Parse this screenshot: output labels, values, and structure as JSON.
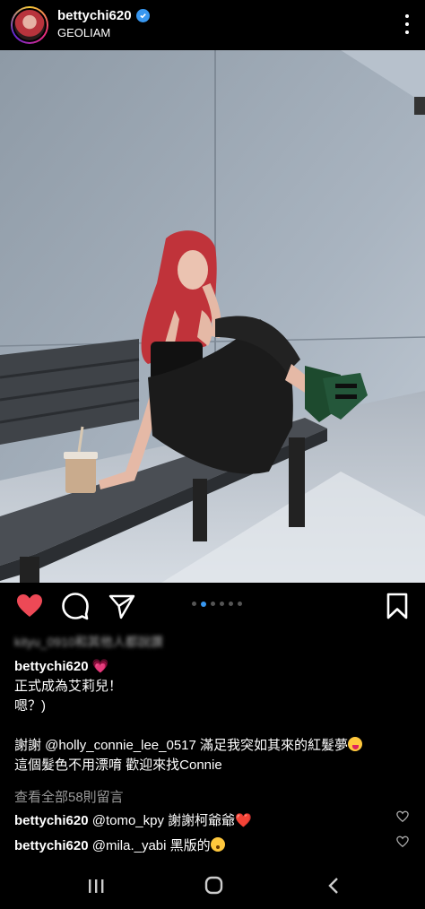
{
  "header": {
    "username": "bettychi620",
    "location": "GEOLIAM",
    "verified": true,
    "avatar_icon": "avatar"
  },
  "post": {
    "carousel": {
      "total": 6,
      "active_index": 1
    },
    "liked_by_text": "kityu_0910和其他人都說讚",
    "caption": {
      "username": "bettychi620",
      "heart": "💗",
      "lines": [
        "正式成為艾莉兒！",
        "嗯？)",
        "",
        "謝謝 @holly_connie_lee_0517 滿足我突如其來的紅髮夢",
        "這個髮色不用漂唷 歡迎來找Connie"
      ],
      "tongue_emoji": "😝"
    },
    "view_all_comments": "查看全部58則留言",
    "comments": [
      {
        "username": "bettychi620",
        "text": "@tomo_kpy 謝謝柯爺爺",
        "emoji": "❤️"
      },
      {
        "username": "bettychi620",
        "text": "@mila._yabi 黑版的",
        "emoji": "😯"
      }
    ]
  },
  "colors": {
    "like": "#ed4956",
    "accent": "#3897f0",
    "muted": "#9a9a9a"
  },
  "icons": {
    "like": "heart-icon",
    "comment": "comment-icon",
    "share": "send-icon",
    "save": "bookmark-icon",
    "more": "more-vertical-icon",
    "nav_recents": "recents-icon",
    "nav_home": "home-icon",
    "nav_back": "back-icon"
  }
}
